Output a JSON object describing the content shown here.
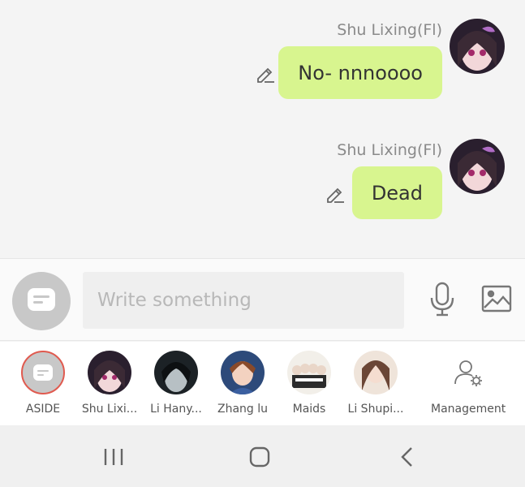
{
  "messages": [
    {
      "sender": "Shu Lixing(Fl)",
      "text": "No- nnnoooo"
    },
    {
      "sender": "Shu Lixing(Fl)",
      "text": "Dead"
    }
  ],
  "composer": {
    "placeholder": "Write something"
  },
  "contacts": [
    {
      "label": "ASIDE"
    },
    {
      "label": "Shu Lixi..."
    },
    {
      "label": "Li Hany..."
    },
    {
      "label": "Zhang lu"
    },
    {
      "label": "Maids"
    },
    {
      "label": "Li Shupi..."
    }
  ],
  "management": {
    "label": "Management"
  },
  "colors": {
    "bubble": "#d8f58f",
    "accent_ring": "#e05a4f"
  }
}
